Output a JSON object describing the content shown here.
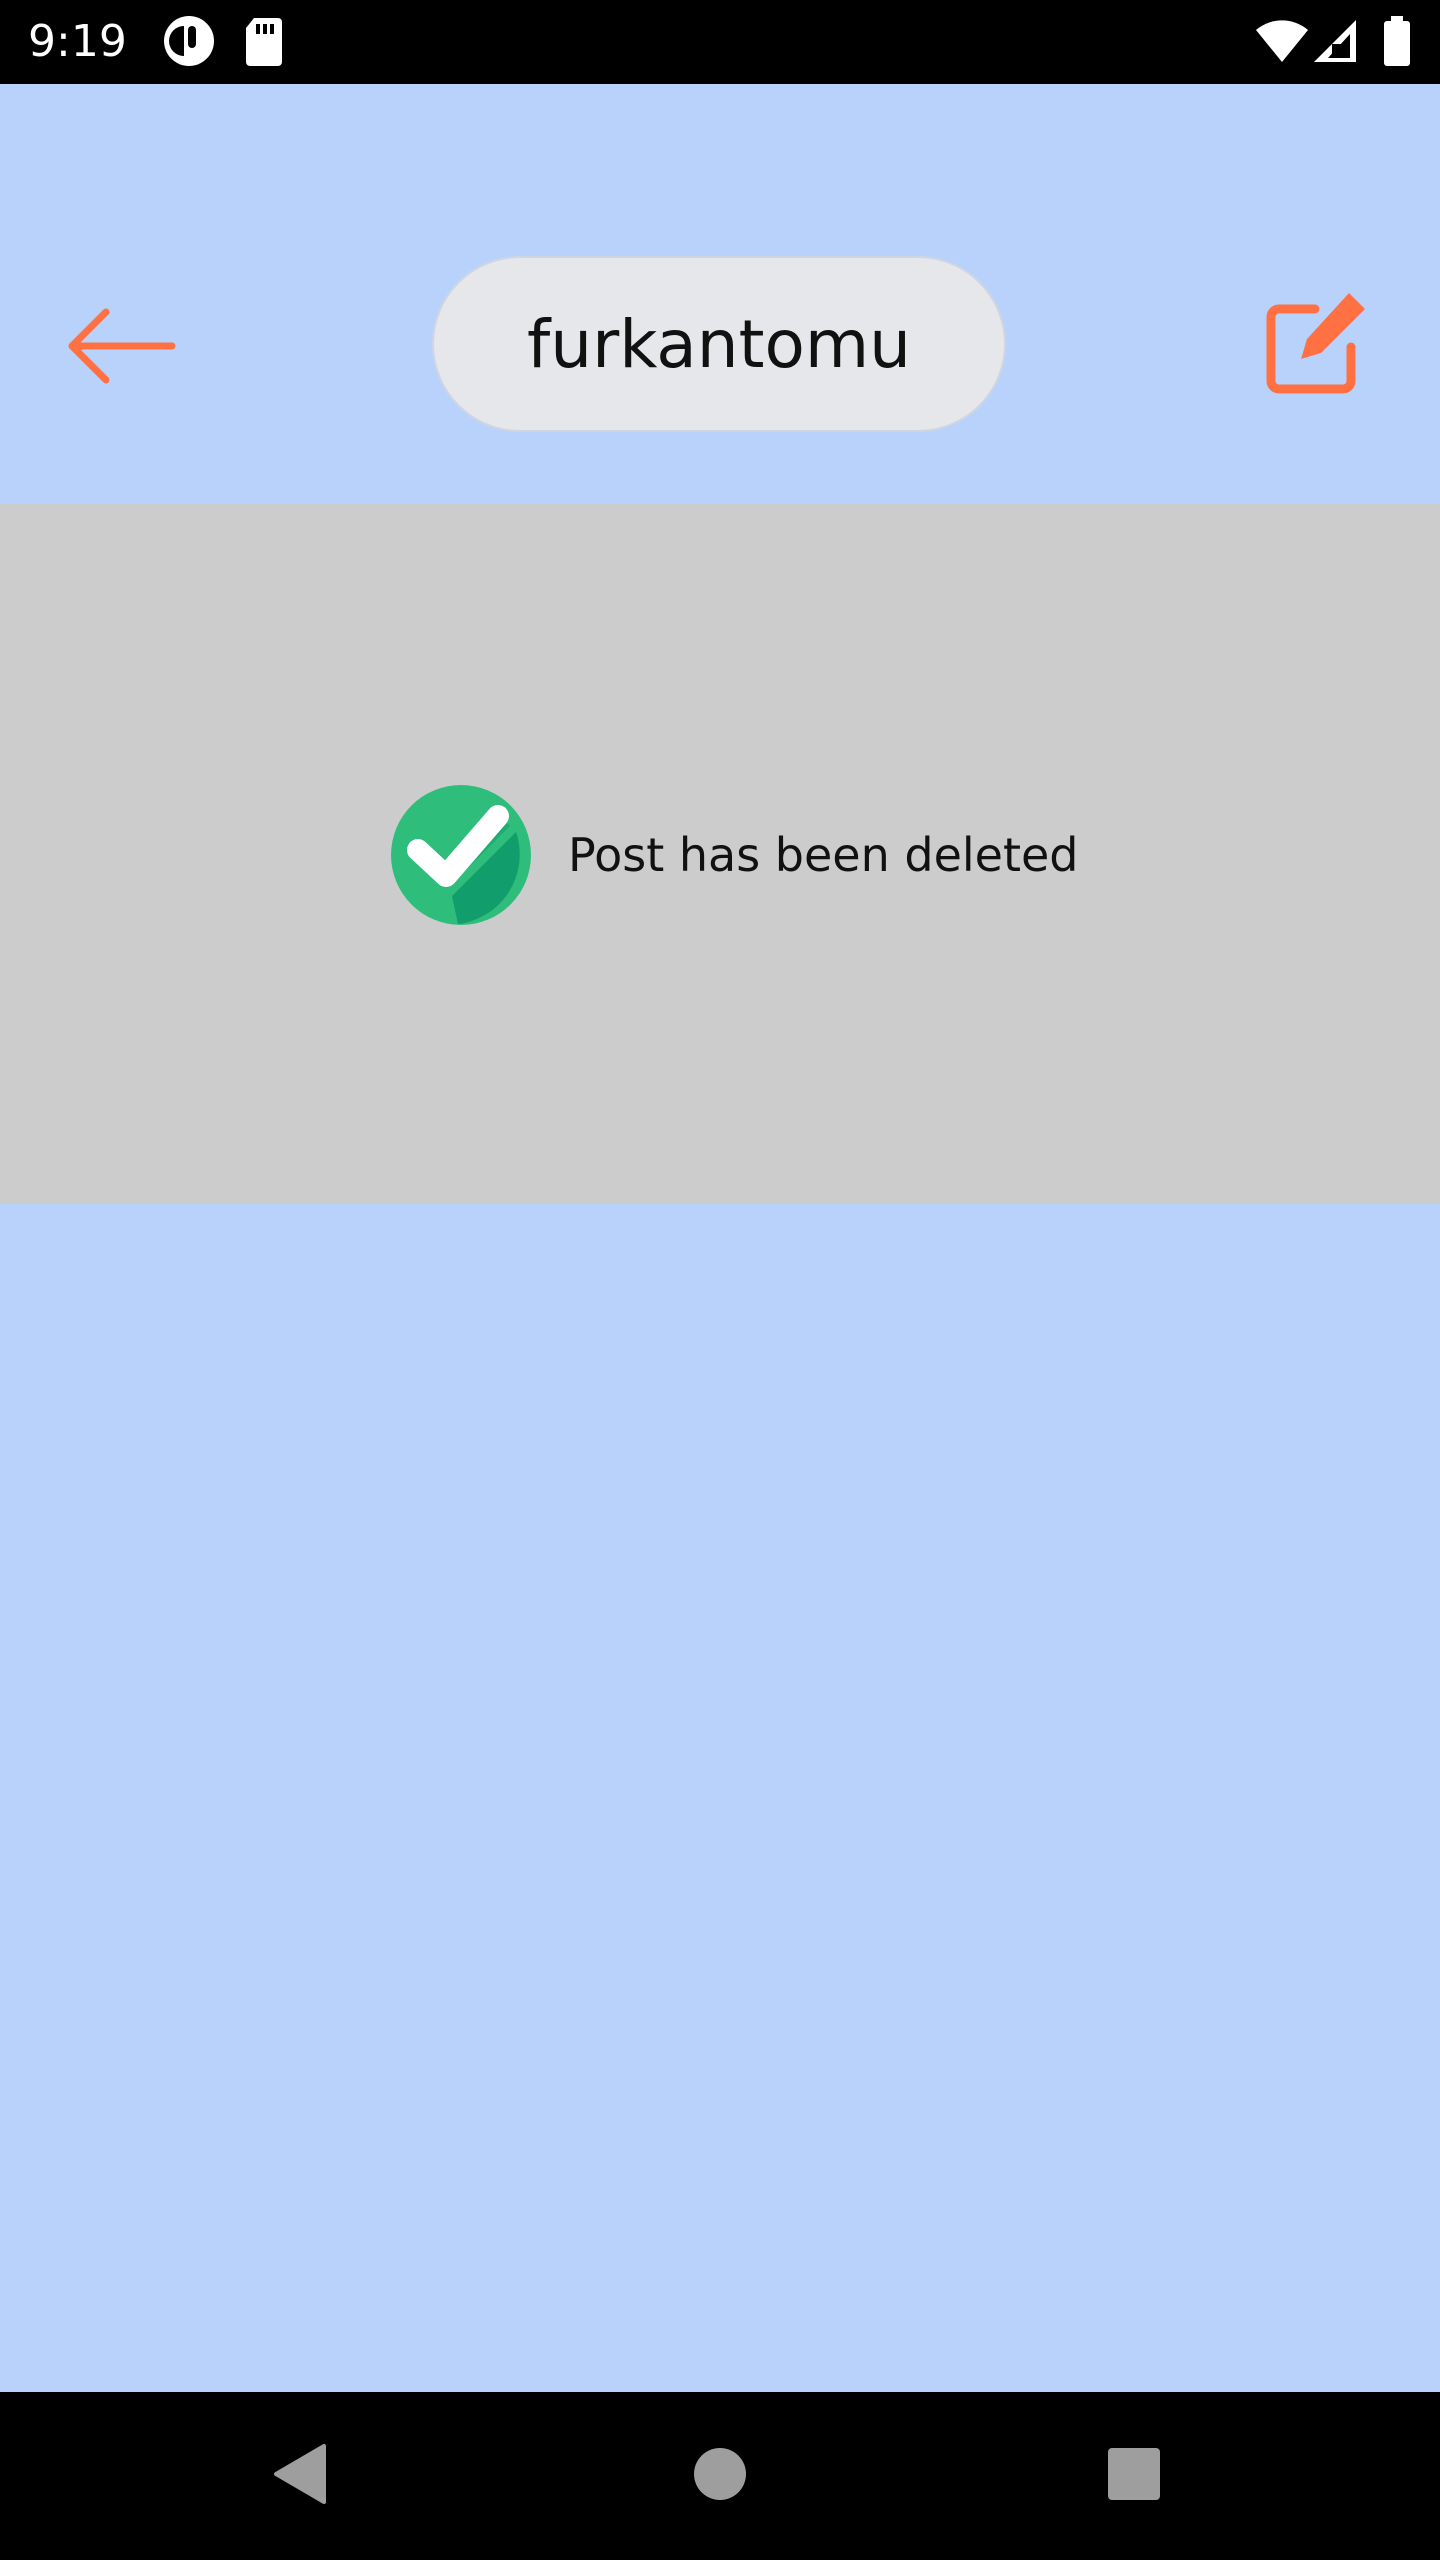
{
  "status_bar": {
    "time": "9:19",
    "icons": [
      "app-notification-icon",
      "sd-card-icon",
      "wifi-icon",
      "cellular-signal-icon",
      "battery-icon"
    ]
  },
  "header": {
    "title": "furkantomu",
    "back_icon": "arrow-left-icon",
    "edit_icon": "edit-icon",
    "accent_color": "#ff7043"
  },
  "notice": {
    "message": "Post has been deleted",
    "icon": "check-circle-icon",
    "icon_color": "#2ebd7b"
  },
  "navigation": {
    "buttons": [
      "back-triangle-icon",
      "home-circle-icon",
      "recents-square-icon"
    ]
  },
  "colors": {
    "background": "#b8d2fc",
    "panel": "#cccccc",
    "pill": "#e5e7eb"
  }
}
